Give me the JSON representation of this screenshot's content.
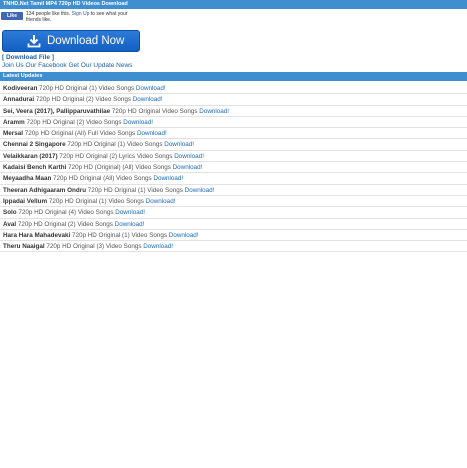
{
  "header": {
    "title": "TNHD.Net Tamil MP4 720p HD Videos Download"
  },
  "facebook": {
    "like_label": "Like",
    "text_before": "134 people like this.",
    "signup_link": "Sign Up",
    "text_after": "to see what your friends like."
  },
  "download_button": {
    "label": "Download Now",
    "icon": "download-icon"
  },
  "download_file_link": "[ Download File ]",
  "join_links": [
    "Join Us Our Facebook",
    "Get Our Update News"
  ],
  "section": {
    "title": "Latest Updates"
  },
  "colors": {
    "bar": "#3f8fd0",
    "button": "#1c6ad0",
    "link": "#1c6ab8"
  },
  "videos": [
    {
      "title": "Kodiveeran",
      "desc": " 720p HD Original (1) Video Songs ",
      "link": "Download!"
    },
    {
      "title": "Annadurai",
      "desc": " 720p HD Original (2) Video Songs ",
      "link": "Download!"
    },
    {
      "title": "Sei, Veera (2017), Pallipparuvathilae",
      "desc": " 720p HD Original Video Songs ",
      "link": "Download!"
    },
    {
      "title": "Aramm",
      "desc": " 720p HD Original (2) Video Songs ",
      "link": "Download!"
    },
    {
      "title": "Mersal",
      "desc": " 720p HD Original (All) Full Video Songs ",
      "link": "Download!"
    },
    {
      "title": "Chennai 2 Singapore",
      "desc": " 720p HD Original (1) Video Songs ",
      "link": "Download!"
    },
    {
      "title": "Velaikkaran (2017)",
      "desc": " 720p HD Original (2) Lyrics Video Songs ",
      "link": "Download!"
    },
    {
      "title": "Kadaisi Bench Karthi",
      "desc": " 720p HD (Original) (All) Video Songs ",
      "link": "Download!"
    },
    {
      "title": "Meyaadha Maan",
      "desc": " 720p HD Original (All) Video Songs ",
      "link": "Download!"
    },
    {
      "title": "Theeran Adhigaaram Ondru",
      "desc": " 720p HD Original (1) Video Songs ",
      "link": "Download!"
    },
    {
      "title": "Ippadai Vellum",
      "desc": " 720p HD Original (1) Video Songs ",
      "link": "Download!"
    },
    {
      "title": "Solo",
      "desc": " 720p HD Original (4) Video Songs ",
      "link": "Download!"
    },
    {
      "title": "Aval",
      "desc": " 720p HD Original (2) Video Songs ",
      "link": "Download!"
    },
    {
      "title": "Hara Hara Mahadevaki",
      "desc": " 720p HD Original (1) Video Songs ",
      "link": "Download!"
    },
    {
      "title": "Theru Naaigal",
      "desc": " 720p HD Original (3) Video Songs ",
      "link": "Download!"
    }
  ]
}
